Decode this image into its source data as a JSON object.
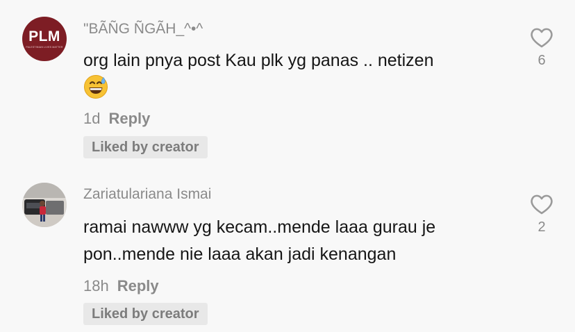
{
  "comments": [
    {
      "username": "\"BÃÑG ÑGÃH_^•^",
      "text": "org lain pnya post Kau plk yg panas .. netizen",
      "emoji": "grinning-face-with-sweat",
      "time": "1d",
      "reply_label": "Reply",
      "badge": "Liked by creator",
      "likes": "6",
      "avatar": {
        "logo_text": "PLM",
        "logo_subtext": "PALESTINIAN LIVES MATTER"
      }
    },
    {
      "username": "Zariatulariana Ismai",
      "text": "ramai nawww yg kecam..mende laaa gurau je pon..mende nie laaa akan jadi kenangan",
      "time": "18h",
      "reply_label": "Reply",
      "badge": "Liked by creator",
      "likes": "2"
    }
  ],
  "colors": {
    "background": "#f8f8f8",
    "avatar_brand": "#7d1d24"
  },
  "icons": {
    "like": "heart-outline-icon"
  }
}
